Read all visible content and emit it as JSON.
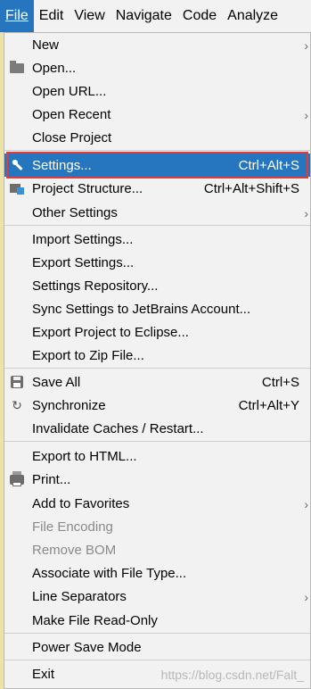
{
  "menubar": {
    "items": [
      {
        "label": "File",
        "mnemonic": "F",
        "rest": "ile"
      },
      {
        "label": "Edit",
        "mnemonic": "E",
        "rest": "dit"
      },
      {
        "label": "View",
        "mnemonic": "V",
        "rest": "iew"
      },
      {
        "label": "Navigate",
        "mnemonic": "N",
        "rest": "avigate"
      },
      {
        "label": "Code",
        "mnemonic": "C",
        "rest": "ode"
      },
      {
        "label": "Analyze",
        "mnemonic": "",
        "rest": "Analyze"
      }
    ]
  },
  "menu": {
    "items": [
      {
        "label": "New",
        "shortcut": "",
        "submenu": true,
        "icon": ""
      },
      {
        "label": "Open...",
        "shortcut": "",
        "submenu": false,
        "icon": "folder-open-icon"
      },
      {
        "label": "Open URL...",
        "shortcut": "",
        "submenu": false,
        "icon": ""
      },
      {
        "label": "Open Recent",
        "shortcut": "",
        "submenu": true,
        "icon": ""
      },
      {
        "label": "Close Project",
        "shortcut": "",
        "submenu": false,
        "icon": ""
      },
      {
        "label": "Settings...",
        "shortcut": "Ctrl+Alt+S",
        "submenu": false,
        "icon": "wrench-icon",
        "selected": true
      },
      {
        "label": "Project Structure...",
        "shortcut": "Ctrl+Alt+Shift+S",
        "submenu": false,
        "icon": "project-structure-icon"
      },
      {
        "label": "Other Settings",
        "shortcut": "",
        "submenu": true,
        "icon": ""
      },
      {
        "label": "Import Settings...",
        "shortcut": "",
        "submenu": false,
        "icon": ""
      },
      {
        "label": "Export Settings...",
        "shortcut": "",
        "submenu": false,
        "icon": ""
      },
      {
        "label": "Settings Repository...",
        "shortcut": "",
        "submenu": false,
        "icon": ""
      },
      {
        "label": "Sync Settings to JetBrains Account...",
        "shortcut": "",
        "submenu": false,
        "icon": ""
      },
      {
        "label": "Export Project to Eclipse...",
        "shortcut": "",
        "submenu": false,
        "icon": ""
      },
      {
        "label": "Export to Zip File...",
        "shortcut": "",
        "submenu": false,
        "icon": ""
      },
      {
        "label": "Save All",
        "shortcut": "Ctrl+S",
        "submenu": false,
        "icon": "save-icon"
      },
      {
        "label": "Synchronize",
        "shortcut": "Ctrl+Alt+Y",
        "submenu": false,
        "icon": "sync-icon"
      },
      {
        "label": "Invalidate Caches / Restart...",
        "shortcut": "",
        "submenu": false,
        "icon": ""
      },
      {
        "label": "Export to HTML...",
        "shortcut": "",
        "submenu": false,
        "icon": ""
      },
      {
        "label": "Print...",
        "shortcut": "",
        "submenu": false,
        "icon": "printer-icon"
      },
      {
        "label": "Add to Favorites",
        "shortcut": "",
        "submenu": true,
        "icon": ""
      },
      {
        "label": "File Encoding",
        "shortcut": "",
        "submenu": false,
        "icon": "",
        "disabled": true
      },
      {
        "label": "Remove BOM",
        "shortcut": "",
        "submenu": false,
        "icon": "",
        "disabled": true
      },
      {
        "label": "Associate with File Type...",
        "shortcut": "",
        "submenu": false,
        "icon": ""
      },
      {
        "label": "Line Separators",
        "shortcut": "",
        "submenu": true,
        "icon": ""
      },
      {
        "label": "Make File Read-Only",
        "shortcut": "",
        "submenu": false,
        "icon": ""
      },
      {
        "label": "Power Save Mode",
        "shortcut": "",
        "submenu": false,
        "icon": ""
      },
      {
        "label": "Exit",
        "shortcut": "",
        "submenu": false,
        "icon": ""
      }
    ]
  },
  "watermark": "https://blog.csdn.net/Falt_",
  "colors": {
    "accent": "#2675bf",
    "highlight_border": "#e03c3c"
  }
}
